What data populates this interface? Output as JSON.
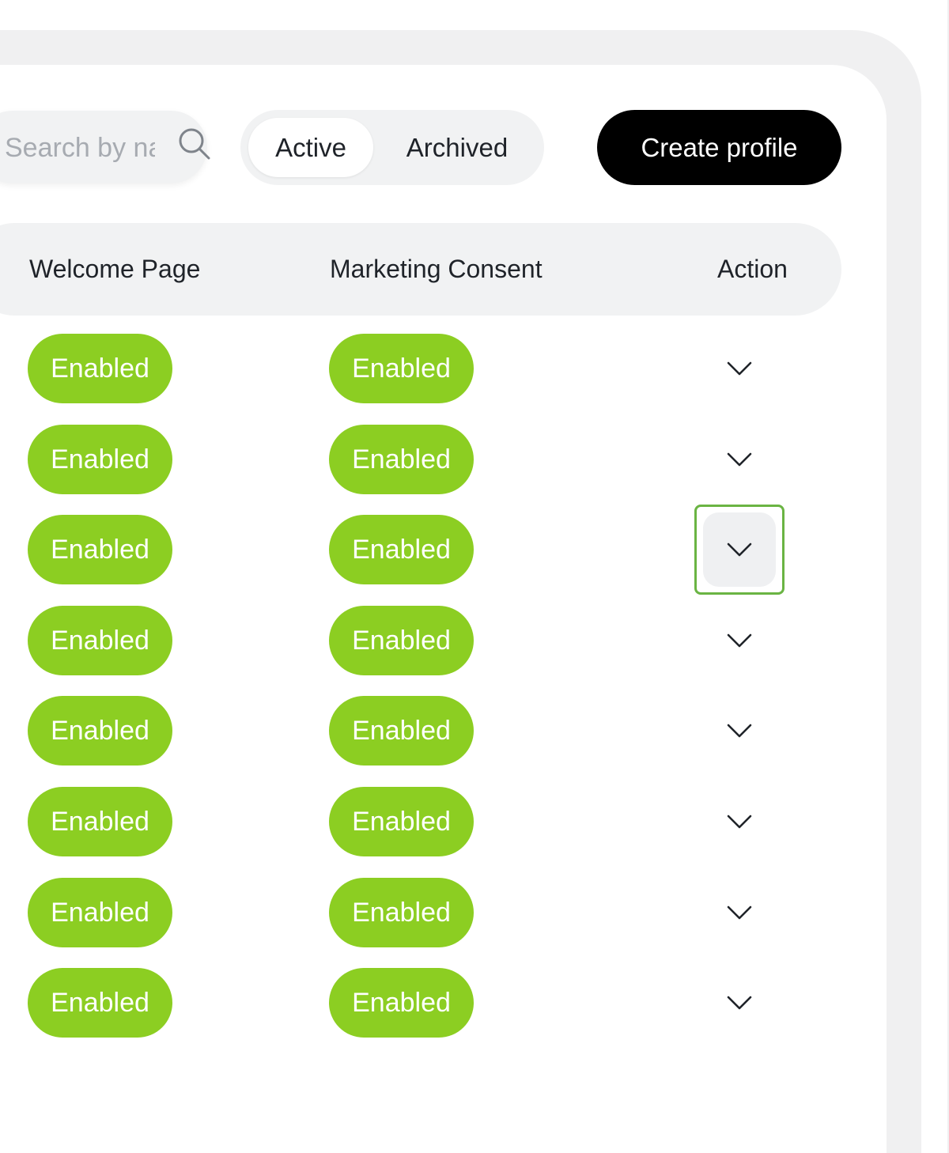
{
  "search": {
    "placeholder": "Search by name"
  },
  "filter_tabs": [
    {
      "label": "Active",
      "selected": true
    },
    {
      "label": "Archived",
      "selected": false
    }
  ],
  "create_button": {
    "label": "Create profile"
  },
  "table": {
    "columns": [
      "Welcome Page",
      "Marketing Consent",
      "Action"
    ],
    "rows": [
      {
        "welcome_page": "Enabled",
        "marketing_consent": "Enabled"
      },
      {
        "welcome_page": "Enabled",
        "marketing_consent": "Enabled"
      },
      {
        "welcome_page": "Enabled",
        "marketing_consent": "Enabled"
      },
      {
        "welcome_page": "Enabled",
        "marketing_consent": "Enabled"
      },
      {
        "welcome_page": "Enabled",
        "marketing_consent": "Enabled"
      },
      {
        "welcome_page": "Enabled",
        "marketing_consent": "Enabled"
      },
      {
        "welcome_page": "Enabled",
        "marketing_consent": "Enabled"
      },
      {
        "welcome_page": "Enabled",
        "marketing_consent": "Enabled"
      }
    ],
    "focused_action_row": 2
  },
  "colors": {
    "enabled_badge": "#8cce22",
    "primary_button": "#000000",
    "focus_ring": "#6ab443"
  },
  "icons": {
    "search": "search-icon",
    "row_action": "chevron-down-icon"
  }
}
